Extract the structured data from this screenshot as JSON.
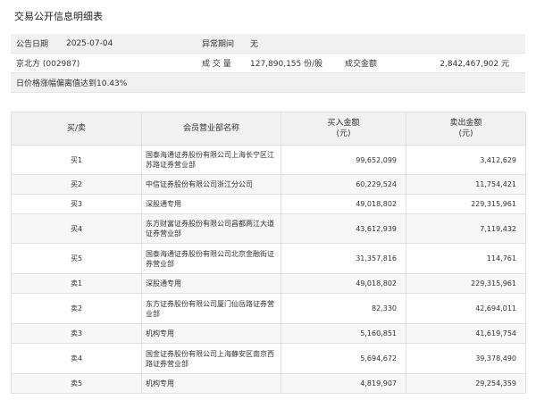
{
  "title": "交易公开信息明细表",
  "info": {
    "date_label": "公告日期",
    "date_value": "2025-07-04",
    "abnormal_label": "异常期间",
    "abnormal_value": "无",
    "stock": "京北方 (002987)",
    "volume_label": "成 交 量",
    "volume_value": "127,890,155 份/股",
    "amount_label": "成交金额",
    "amount_value": "2,842,467,902 元",
    "reason": "日价格涨幅偏离值达到10.43%"
  },
  "table": {
    "headers": {
      "side": "买/卖",
      "name": "会员营业部名称",
      "buy": "买入金额",
      "buy_unit": "(元)",
      "sell": "卖出金额",
      "sell_unit": "(元)"
    },
    "rows": [
      {
        "side": "买1",
        "name": "国泰海通证券股份有限公司上海长宁区江苏路证券营业部",
        "buy": "99,652,099",
        "sell": "3,412,629"
      },
      {
        "side": "买2",
        "name": "中信证券股份有限公司浙江分公司",
        "buy": "60,229,524",
        "sell": "11,754,421"
      },
      {
        "side": "买3",
        "name": "深股通专用",
        "buy": "49,018,802",
        "sell": "229,315,961"
      },
      {
        "side": "买4",
        "name": "东方财富证券股份有限公司昌都两江大道证券营业部",
        "buy": "43,612,939",
        "sell": "7,119,432"
      },
      {
        "side": "买5",
        "name": "国泰海通证券股份有限公司北京金融街证券营业部",
        "buy": "31,357,816",
        "sell": "114,761"
      },
      {
        "side": "卖1",
        "name": "深股通专用",
        "buy": "49,018,802",
        "sell": "229,315,961"
      },
      {
        "side": "卖2",
        "name": "东方证券股份有限公司厦门仙岳路证券营业部",
        "buy": "82,330",
        "sell": "42,694,011"
      },
      {
        "side": "卖3",
        "name": "机构专用",
        "buy": "5,160,851",
        "sell": "41,619,754"
      },
      {
        "side": "卖4",
        "name": "国金证券股份有限公司上海静安区南京西路证券营业部",
        "buy": "5,694,672",
        "sell": "39,378,490"
      },
      {
        "side": "卖5",
        "name": "机构专用",
        "buy": "4,819,907",
        "sell": "29,254,359"
      }
    ]
  }
}
